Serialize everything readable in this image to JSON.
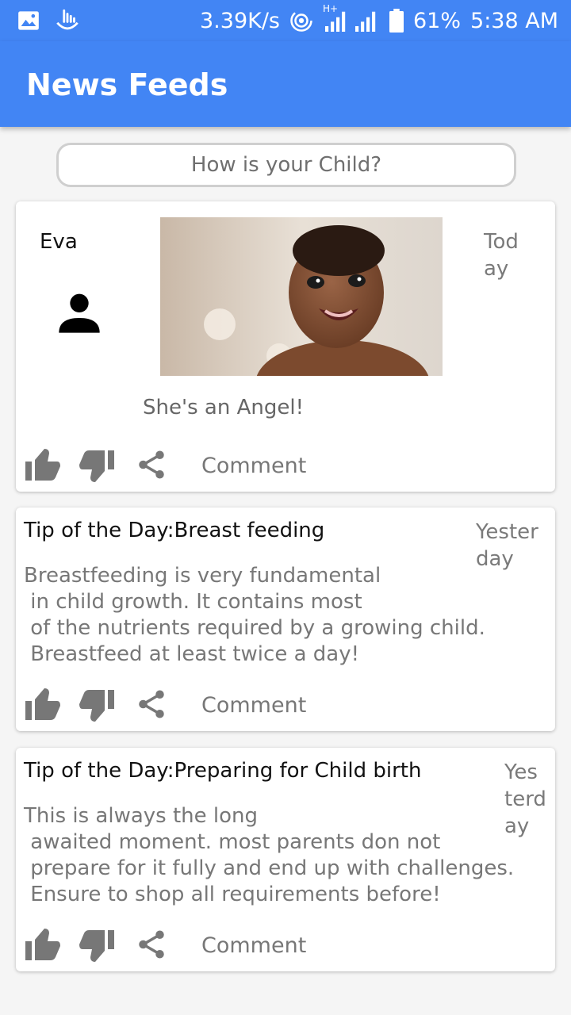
{
  "status_bar": {
    "speed": "3.39K/s",
    "network": "H+",
    "battery": "61%",
    "time": "5:38 AM"
  },
  "app_bar": {
    "title": "News Feeds"
  },
  "prompt": {
    "label": "How is your Child?"
  },
  "posts": [
    {
      "author": "Eva",
      "date": [
        "Tod",
        "ay"
      ],
      "caption": "She's an Angel!",
      "comment_label": "Comment"
    },
    {
      "title": "Tip of the Day:Breast feeding",
      "date": [
        "Yester",
        "day"
      ],
      "body": "Breastfeeding is very fundamental\n in child growth. It contains most\n of the nutrients required by a growing child.\n Breastfeed at least twice a day!",
      "comment_label": "Comment"
    },
    {
      "title": "Tip of the Day:Preparing for Child birth",
      "date": [
        "Yes",
        "terd",
        "ay"
      ],
      "body": "This is always the long\n awaited moment. most parents don not\n prepare for it fully and end up with challenges.\n Ensure to shop all requirements before!",
      "comment_label": "Comment"
    }
  ],
  "colors": {
    "primary": "#4285f4",
    "icon_gray": "#777777"
  }
}
